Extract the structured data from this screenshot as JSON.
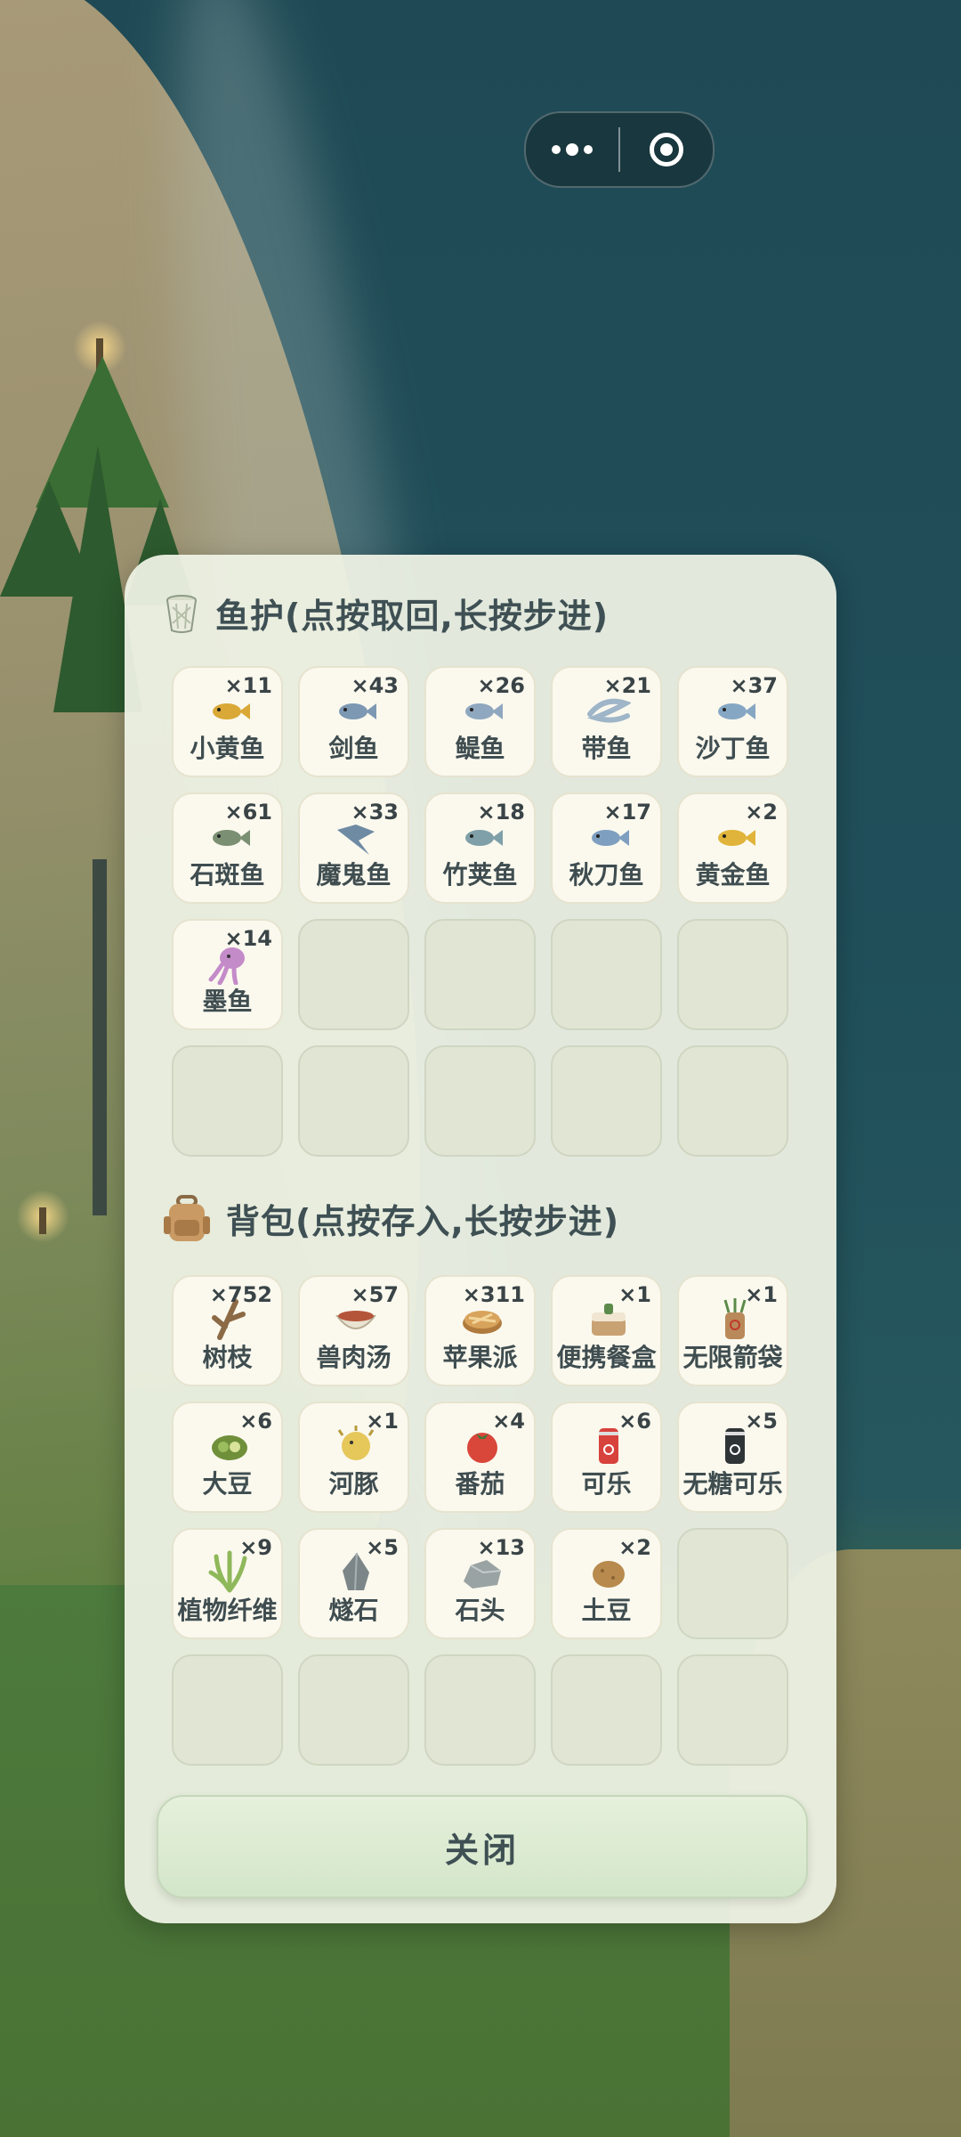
{
  "window_controls": {
    "more_icon": "more-dots-icon",
    "close_icon": "target-circle-icon"
  },
  "fish_storage": {
    "title": "鱼护(点按取回,长按步进)",
    "icon": "bucket-icon",
    "items": [
      {
        "name": "小黄鱼",
        "count": "×11",
        "icon": "fish-icon",
        "color": "#d9a836"
      },
      {
        "name": "剑鱼",
        "count": "×43",
        "icon": "fish-icon",
        "color": "#7d98b3"
      },
      {
        "name": "鳀鱼",
        "count": "×26",
        "icon": "fish-icon",
        "color": "#8fa8bf"
      },
      {
        "name": "带鱼",
        "count": "×21",
        "icon": "ribbonfish-icon",
        "color": "#9fb5c8"
      },
      {
        "name": "沙丁鱼",
        "count": "×37",
        "icon": "fish-icon",
        "color": "#86a7c4"
      },
      {
        "name": "石斑鱼",
        "count": "×61",
        "icon": "fish-icon",
        "color": "#7b8f72"
      },
      {
        "name": "魔鬼鱼",
        "count": "×33",
        "icon": "ray-icon",
        "color": "#6f8aa3"
      },
      {
        "name": "竹荚鱼",
        "count": "×18",
        "icon": "fish-icon",
        "color": "#7fa0a8"
      },
      {
        "name": "秋刀鱼",
        "count": "×17",
        "icon": "fish-icon",
        "color": "#7f9fc0"
      },
      {
        "name": "黄金鱼",
        "count": "×2",
        "icon": "fish-icon",
        "color": "#e0b43a"
      },
      {
        "name": "墨鱼",
        "count": "×14",
        "icon": "squid-icon",
        "color": "#c48bc9"
      }
    ],
    "total_slots": 20
  },
  "backpack": {
    "title": "背包(点按存入,长按步进)",
    "icon": "backpack-icon",
    "items": [
      {
        "name": "树枝",
        "count": "×752",
        "icon": "branch-icon",
        "color": "#8b6a45"
      },
      {
        "name": "兽肉汤",
        "count": "×57",
        "icon": "stew-icon",
        "color": "#b4553a"
      },
      {
        "name": "苹果派",
        "count": "×311",
        "icon": "pie-icon",
        "color": "#d8a35c"
      },
      {
        "name": "便携餐盒",
        "count": "×1",
        "icon": "lunchbox-icon",
        "color": "#c9a274"
      },
      {
        "name": "无限箭袋",
        "count": "×1",
        "icon": "quiver-icon",
        "color": "#b9895a"
      },
      {
        "name": "大豆",
        "count": "×6",
        "icon": "soybean-icon",
        "color": "#9bbd5e"
      },
      {
        "name": "河豚",
        "count": "×1",
        "icon": "pufferfish-icon",
        "color": "#e5c75a"
      },
      {
        "name": "番茄",
        "count": "×4",
        "icon": "tomato-icon",
        "color": "#d9463a"
      },
      {
        "name": "可乐",
        "count": "×6",
        "icon": "cola-can-icon",
        "color": "#d8423c"
      },
      {
        "name": "无糖可乐",
        "count": "×5",
        "icon": "zero-cola-can-icon",
        "color": "#2f3436"
      },
      {
        "name": "植物纤维",
        "count": "×9",
        "icon": "plant-fiber-icon",
        "color": "#8fb85a"
      },
      {
        "name": "燧石",
        "count": "×5",
        "icon": "flint-icon",
        "color": "#7c8688"
      },
      {
        "name": "石头",
        "count": "×13",
        "icon": "stone-icon",
        "color": "#9aa3a3"
      },
      {
        "name": "土豆",
        "count": "×2",
        "icon": "potato-icon",
        "color": "#b88a4d"
      }
    ],
    "total_slots": 20
  },
  "close_button": {
    "label": "关闭"
  }
}
